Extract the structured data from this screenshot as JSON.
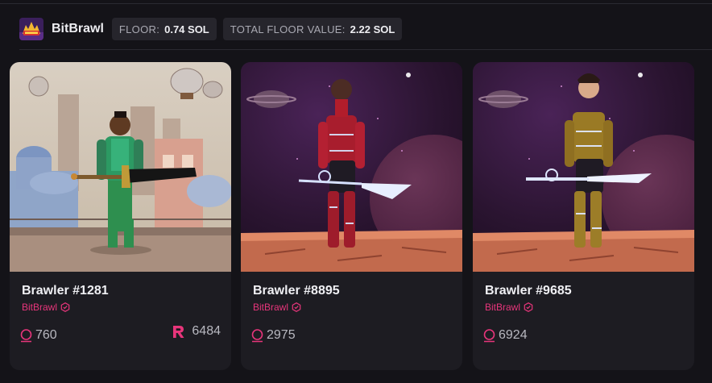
{
  "header": {
    "collection_name": "BitBrawl",
    "floor_label": "FLOOR:",
    "floor_value": "0.74 SOL",
    "total_floor_label": "TOTAL FLOOR VALUE:",
    "total_floor_value": "2.22 SOL"
  },
  "colors": {
    "background": "#141318",
    "card": "#1d1c22",
    "pill": "#26252c",
    "accent_pink": "#e8357b",
    "muted_text": "#b8b8c0"
  },
  "cards": [
    {
      "title": "Brawler #1281",
      "collection": "BitBrawl",
      "rank": "760",
      "rarity_score": "6484",
      "scene": "steampunk-city"
    },
    {
      "title": "Brawler #8895",
      "collection": "BitBrawl",
      "rank": "2975",
      "scene": "space-red-armor"
    },
    {
      "title": "Brawler #9685",
      "collection": "BitBrawl",
      "rank": "6924",
      "scene": "space-gold-armor"
    }
  ],
  "icons": {
    "collection_logo": "bitbrawl-logo-icon",
    "verified": "verified-badge-icon",
    "rank": "rank-icon",
    "rarity": "rarity-r-icon"
  }
}
